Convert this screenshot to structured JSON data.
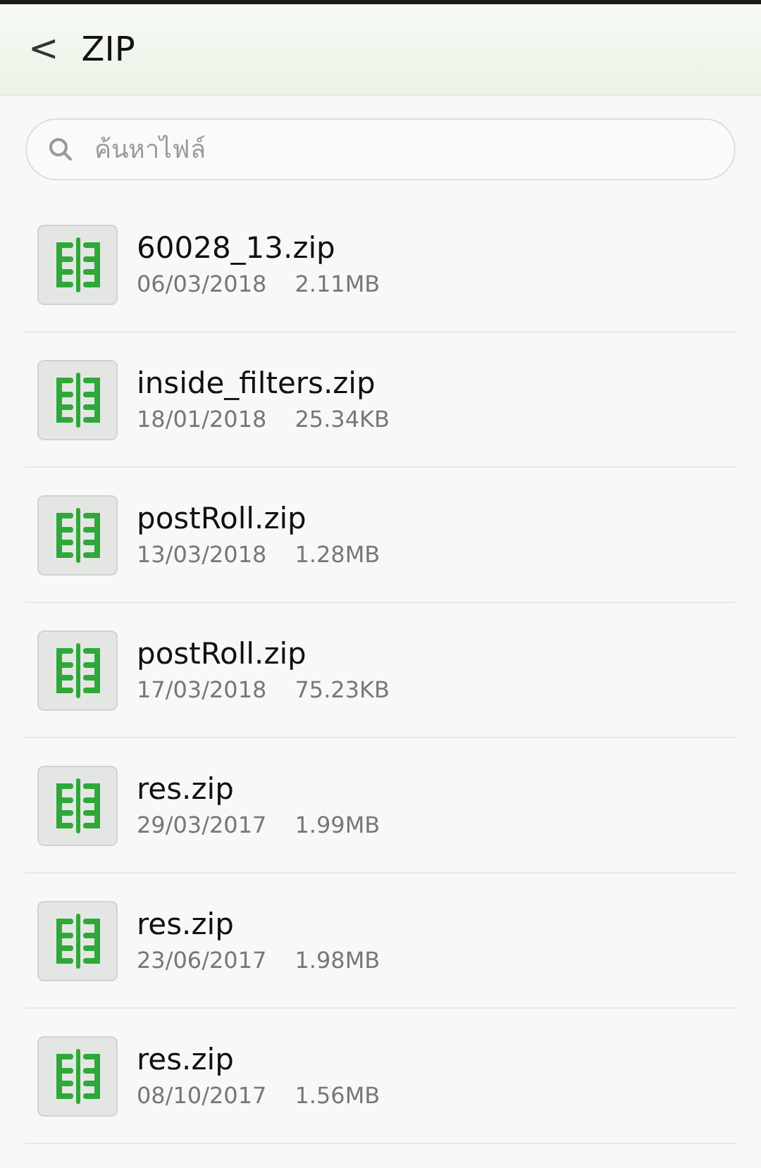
{
  "header": {
    "back": "<",
    "title": "ZIP"
  },
  "search": {
    "placeholder": "ค้นหาไฟล์"
  },
  "files": [
    {
      "name": "60028_13.zip",
      "date": "06/03/2018",
      "size": "2.11MB"
    },
    {
      "name": "inside_filters.zip",
      "date": "18/01/2018",
      "size": "25.34KB"
    },
    {
      "name": "postRoll.zip",
      "date": "13/03/2018",
      "size": "1.28MB"
    },
    {
      "name": "postRoll.zip",
      "date": "17/03/2018",
      "size": "75.23KB"
    },
    {
      "name": "res.zip",
      "date": "29/03/2017",
      "size": "1.99MB"
    },
    {
      "name": "res.zip",
      "date": "23/06/2017",
      "size": "1.98MB"
    },
    {
      "name": "res.zip",
      "date": "08/10/2017",
      "size": "1.56MB"
    }
  ]
}
